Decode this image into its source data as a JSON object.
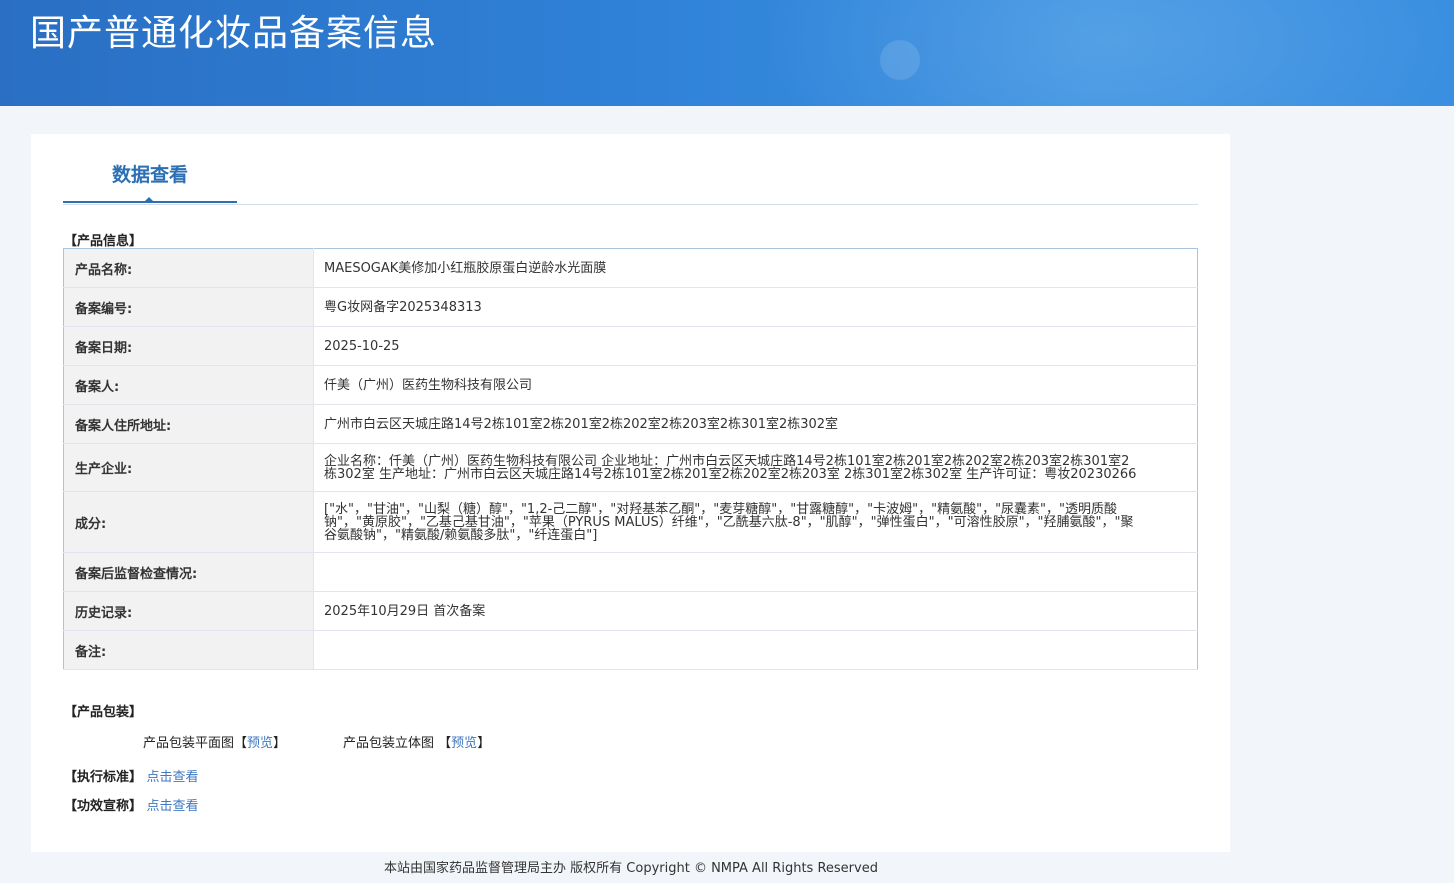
{
  "header": {
    "title": "国产普通化妆品备案信息"
  },
  "tabs": {
    "active_label": "数据查看"
  },
  "product_info": {
    "section_title": "【产品信息】",
    "rows": [
      {
        "label": "产品名称:",
        "value": "MAESOGAK美修加小红瓶胶原蛋白逆龄水光面膜"
      },
      {
        "label": "备案编号:",
        "value": "粤G妆网备字2025348313"
      },
      {
        "label": "备案日期:",
        "value": "2025-10-25"
      },
      {
        "label": "备案人:",
        "value": "仟美（广州）医药生物科技有限公司"
      },
      {
        "label": "备案人住所地址:",
        "value": "广州市白云区天城庄路14号2栋101室2栋201室2栋202室2栋203室2栋301室2栋302室"
      },
      {
        "label": "生产企业:",
        "value": "企业名称：仟美（广州）医药生物科技有限公司 企业地址：广州市白云区天城庄路14号2栋101室2栋201室2栋202室2栋203室2栋301室2栋302室 生产地址：广州市白云区天城庄路14号2栋101室2栋201室2栋202室2栋203室 2栋301室2栋302室 生产许可证：粤妆20230266"
      },
      {
        "label": "成分:",
        "value": "[\"水\"，\"甘油\"，\"山梨（糖）醇\"，\"1,2-己二醇\"，\"对羟基苯乙酮\"，\"麦芽糖醇\"，\"甘露糖醇\"，\"卡波姆\"，\"精氨酸\"，\"尿囊素\"，\"透明质酸钠\"，\"黄原胶\"，\"乙基己基甘油\"，\"苹果（PYRUS MALUS）纤维\"，\"乙酰基六肽-8\"，\"肌醇\"，\"弹性蛋白\"，\"可溶性胶原\"，\"羟脯氨酸\"，\"聚谷氨酸钠\"，\"精氨酸/赖氨酸多肽\"，\"纤连蛋白\"]"
      },
      {
        "label": "备案后监督检查情况:",
        "value": ""
      },
      {
        "label": "历史记录:",
        "value": "2025年10月29日 首次备案"
      },
      {
        "label": "备注:",
        "value": ""
      }
    ]
  },
  "packaging": {
    "section_title": "【产品包装】",
    "flat_label": "产品包装平面图",
    "flat_preview": "预览",
    "solid_label": "产品包装立体图",
    "solid_preview": "预览",
    "bracket_open": "【",
    "bracket_close": "】"
  },
  "standard": {
    "section_title": "【执行标准】",
    "link": "点击查看"
  },
  "efficacy": {
    "section_title": "【功效宣称】",
    "link": "点击查看"
  },
  "footer": {
    "text": "本站由国家药品监督管理局主办 版权所有 Copyright © NMPA All Rights Reserved"
  }
}
